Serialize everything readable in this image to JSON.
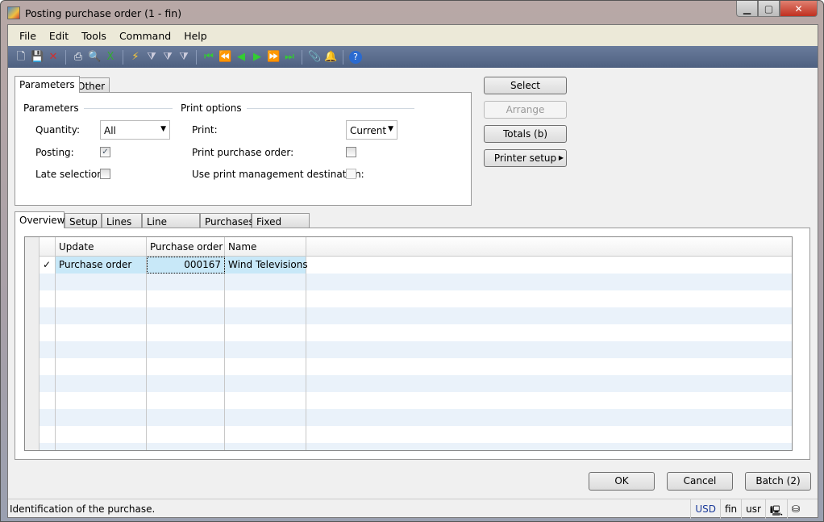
{
  "window": {
    "title": "Posting purchase order (1 - fin)",
    "minimize": "▁",
    "maximize": "▢",
    "close": "✕"
  },
  "menu": [
    "File",
    "Edit",
    "Tools",
    "Command",
    "Help"
  ],
  "toolbar": [
    "new-icon",
    "save-icon",
    "delete-icon",
    "print-icon",
    "print-preview-icon",
    "export-excel-icon",
    "filter-by-selection-icon",
    "filter-by-grid-icon",
    "advanced-filter-icon",
    "remove-filter-icon",
    "first-record-icon",
    "previous-page-icon",
    "previous-record-icon",
    "next-record-icon",
    "next-page-icon",
    "last-record-icon",
    "attachment-icon",
    "alert-icon",
    "help-icon"
  ],
  "top_tabs": [
    "Parameters",
    "Other"
  ],
  "parameters": {
    "group_label": "Parameters",
    "quantity_label": "Quantity:",
    "quantity_value": "All",
    "posting_label": "Posting:",
    "posting_checked": true,
    "late_selection_label": "Late selection:",
    "late_selection_checked": false
  },
  "print_options": {
    "group_label": "Print options",
    "print_label": "Print:",
    "print_value": "Current",
    "print_po_label": "Print purchase order:",
    "print_po_checked": false,
    "use_pm_label": "Use print management destination:",
    "use_pm_checked": false
  },
  "side_buttons": {
    "select": "Select",
    "arrange": "Arrange",
    "totals": "Totals (b)",
    "printer_setup": "Printer setup"
  },
  "bottom_tabs": [
    "Overview",
    "Setup",
    "Lines",
    "Line details",
    "Purchases",
    "Fixed assets"
  ],
  "grid": {
    "columns": [
      "Update",
      "Purchase order",
      "Name"
    ],
    "rows": [
      {
        "mark": "✓",
        "update": "Purchase order",
        "purchase_order": "000167",
        "name": "Wind Televisions"
      }
    ]
  },
  "footer_buttons": {
    "ok": "OK",
    "cancel": "Cancel",
    "batch": "Batch (2)"
  },
  "status": {
    "text": "Identification of the purchase.",
    "currency": "USD",
    "company": "fin",
    "layer": "usr"
  },
  "colors": {
    "toolbar": "#4e6080",
    "selected_row": "#c8e8f8",
    "alt_row": "#eaf2fa"
  }
}
